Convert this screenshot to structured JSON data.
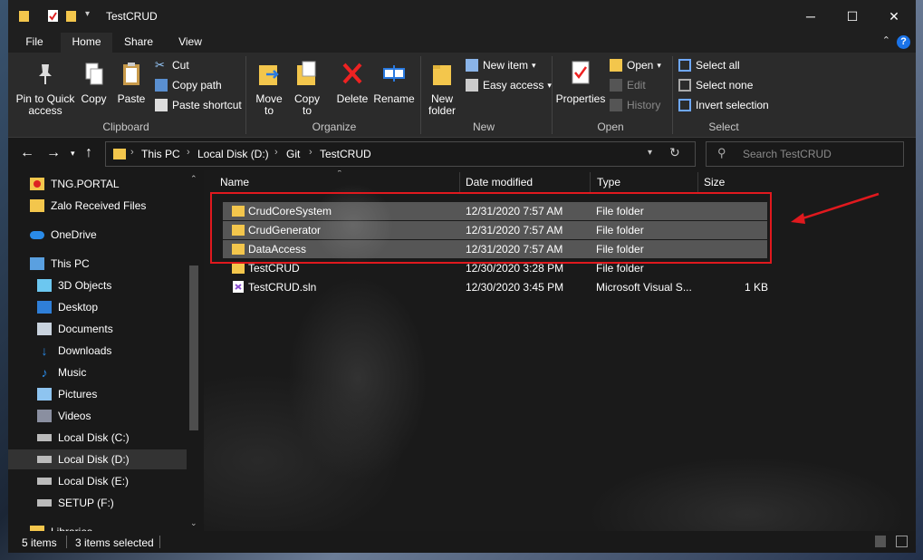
{
  "window": {
    "title": "TestCRUD",
    "controls": {
      "minimize": "─",
      "maximize": "☐",
      "close": "✕"
    }
  },
  "tabs": [
    {
      "label": "File"
    },
    {
      "label": "Home"
    },
    {
      "label": "Share"
    },
    {
      "label": "View"
    }
  ],
  "ribbon": {
    "clipboard": {
      "group": "Clipboard",
      "pin": "Pin to Quick access",
      "copy": "Copy",
      "paste": "Paste",
      "cut": "Cut",
      "copy_path": "Copy path",
      "paste_shortcut": "Paste shortcut"
    },
    "organize": {
      "group": "Organize",
      "move_to": "Move to",
      "copy_to": "Copy to",
      "delete": "Delete",
      "rename": "Rename"
    },
    "new": {
      "group": "New",
      "new_folder": "New folder",
      "new_item": "New item",
      "easy_access": "Easy access"
    },
    "open": {
      "group": "Open",
      "properties": "Properties",
      "open": "Open",
      "edit": "Edit",
      "history": "History"
    },
    "select": {
      "group": "Select",
      "select_all": "Select all",
      "select_none": "Select none",
      "invert": "Invert selection"
    }
  },
  "nav": {
    "breadcrumb": [
      "This PC",
      "Local Disk (D:)",
      "Git",
      "TestCRUD"
    ],
    "search_placeholder": "Search TestCRUD"
  },
  "sidebar": {
    "items": [
      {
        "label": "TNG.PORTAL",
        "icon": "pdf-folder-icon"
      },
      {
        "label": "Zalo Received Files",
        "icon": "folder-icon"
      },
      {
        "label": "OneDrive",
        "icon": "cloud-icon"
      },
      {
        "label": "This PC",
        "icon": "computer-icon"
      },
      {
        "label": "3D Objects",
        "icon": "cube-icon"
      },
      {
        "label": "Desktop",
        "icon": "desktop-icon"
      },
      {
        "label": "Documents",
        "icon": "document-icon"
      },
      {
        "label": "Downloads",
        "icon": "download-icon"
      },
      {
        "label": "Music",
        "icon": "music-icon"
      },
      {
        "label": "Pictures",
        "icon": "picture-icon"
      },
      {
        "label": "Videos",
        "icon": "video-icon"
      },
      {
        "label": "Local Disk (C:)",
        "icon": "drive-icon"
      },
      {
        "label": "Local Disk (D:)",
        "icon": "drive-icon"
      },
      {
        "label": "Local Disk (E:)",
        "icon": "drive-icon"
      },
      {
        "label": "SETUP (F:)",
        "icon": "drive-icon"
      },
      {
        "label": "Libraries",
        "icon": "library-icon"
      }
    ]
  },
  "columns": {
    "name": "Name",
    "date": "Date modified",
    "type": "Type",
    "size": "Size"
  },
  "files": [
    {
      "name": "CrudCoreSystem",
      "date": "12/31/2020 7:57 AM",
      "type": "File folder",
      "size": ""
    },
    {
      "name": "CrudGenerator",
      "date": "12/31/2020 7:57 AM",
      "type": "File folder",
      "size": ""
    },
    {
      "name": "DataAccess",
      "date": "12/31/2020 7:57 AM",
      "type": "File folder",
      "size": ""
    },
    {
      "name": "TestCRUD",
      "date": "12/30/2020 3:28 PM",
      "type": "File folder",
      "size": ""
    },
    {
      "name": "TestCRUD.sln",
      "date": "12/30/2020 3:45 PM",
      "type": "Microsoft Visual S...",
      "size": "1 KB"
    }
  ],
  "status": {
    "count": "5 items",
    "selected": "3 items selected"
  },
  "colors": {
    "highlight": "#e0191e",
    "accent": "#1a73e8",
    "folder": "#f3c64c"
  }
}
